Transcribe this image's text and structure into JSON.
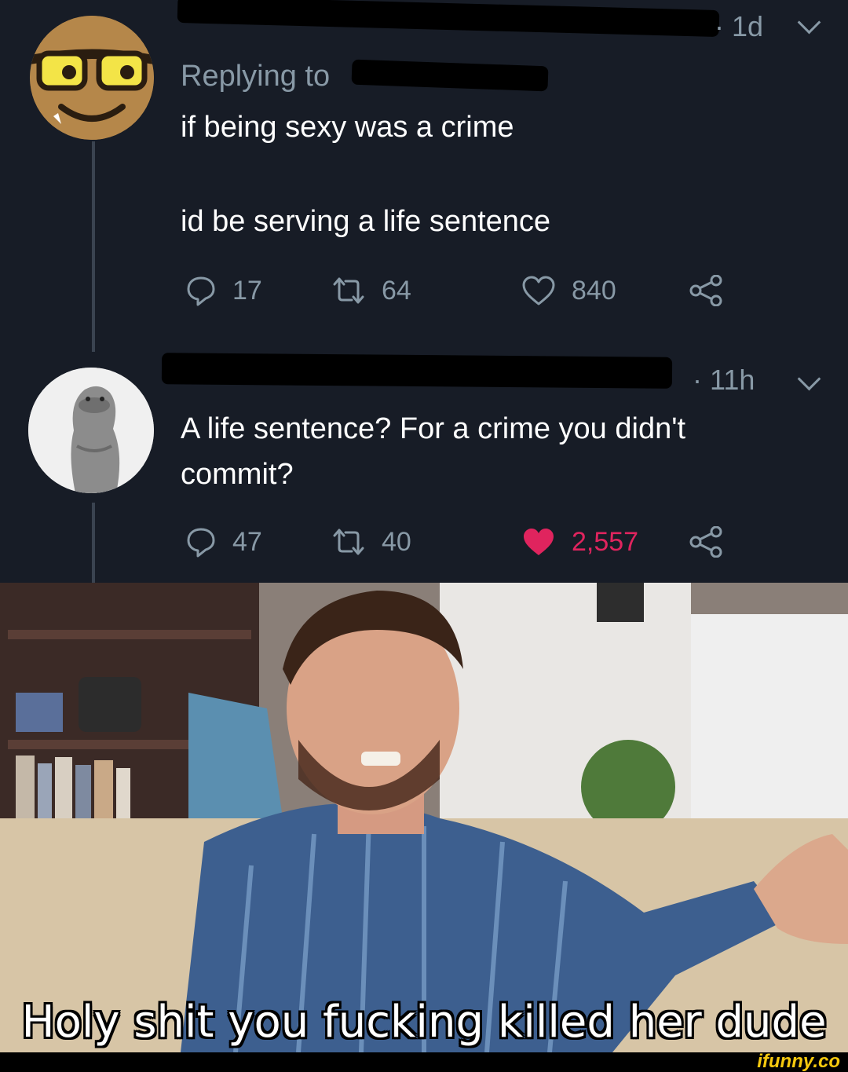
{
  "tweet1": {
    "timestamp": "· 1d",
    "replying_to": "Replying to",
    "text_line1": "if being sexy was a crime",
    "text_line2": "id be serving a life sentence",
    "replies": "17",
    "retweets": "64",
    "likes": "840"
  },
  "tweet2": {
    "timestamp": "· 11h",
    "text_line1": "A life sentence? For a crime you didn't",
    "text_line2": "commit?",
    "replies": "47",
    "retweets": "40",
    "likes": "2,557",
    "liked": true
  },
  "meme": {
    "caption": "Holy shit you fucking killed her dude"
  },
  "watermark": "ifunny.co",
  "colors": {
    "background": "#171c26",
    "muted_text": "#8899a6",
    "like_red": "#e0245e",
    "thread_line": "#3a4350"
  }
}
